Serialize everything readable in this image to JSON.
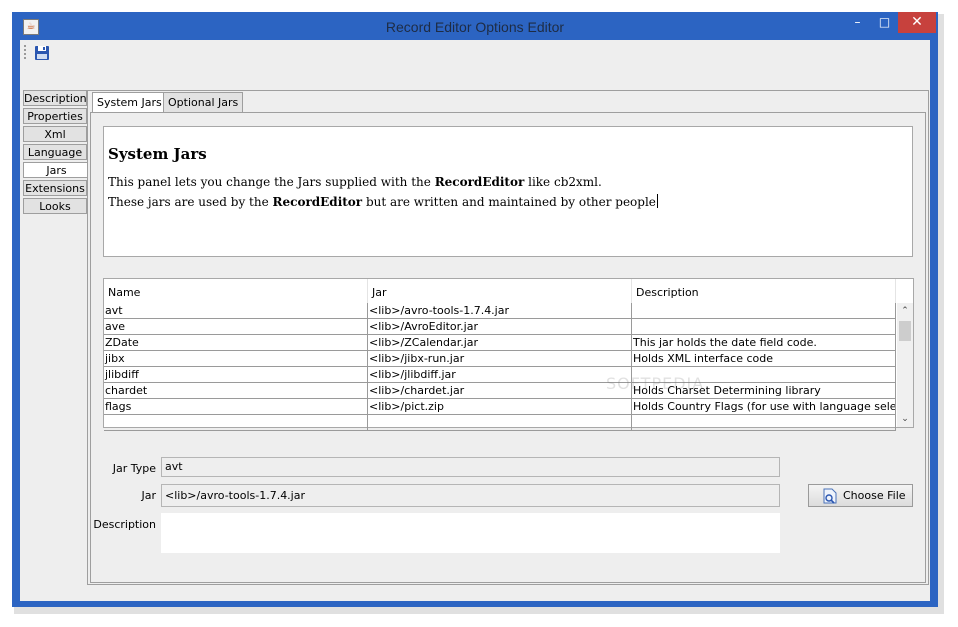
{
  "window": {
    "title": "Record Editor Options Editor",
    "app_icon": "java-icon",
    "controls": {
      "minimize": "–",
      "maximize": "□",
      "close": "✕"
    }
  },
  "toolbar": {
    "save_icon": "save-icon"
  },
  "side_tabs": [
    {
      "label": "Description",
      "active": false
    },
    {
      "label": "Properties",
      "active": false
    },
    {
      "label": "Xml",
      "active": false
    },
    {
      "label": "Language",
      "active": false
    },
    {
      "label": "Jars",
      "active": true
    },
    {
      "label": "Extensions",
      "active": false
    },
    {
      "label": "Looks",
      "active": false
    }
  ],
  "top_tabs": [
    {
      "label": "System Jars",
      "active": true
    },
    {
      "label": "Optional Jars",
      "active": false
    }
  ],
  "info": {
    "title": "System Jars",
    "line1_pre": "This panel lets you change the Jars supplied with the ",
    "line1_bold": "RecordEditor",
    "line1_post": " like cb2xml.",
    "line2_pre": "These jars are used by the ",
    "line2_bold": "RecordEditor",
    "line2_post": " but are written and maintained by other people"
  },
  "table": {
    "columns": [
      "Name",
      "Jar",
      "Description"
    ],
    "rows": [
      [
        "avt",
        "<lib>/avro-tools-1.7.4.jar",
        ""
      ],
      [
        "ave",
        "<lib>/AvroEditor.jar",
        ""
      ],
      [
        "ZDate",
        "<lib>/ZCalendar.jar",
        "This jar holds the date field code."
      ],
      [
        "jibx",
        "<lib>/jibx-run.jar",
        "Holds XML interface code"
      ],
      [
        "jlibdiff",
        "<lib>/jlibdiff.jar",
        ""
      ],
      [
        "chardet",
        "<lib>/chardet.jar",
        "Holds Charset Determining library"
      ],
      [
        "flags",
        "<lib>/pict.zip",
        "Holds Country Flags (for use with language selection)"
      ],
      [
        "",
        "",
        ""
      ]
    ]
  },
  "form": {
    "jar_type_label": "Jar Type",
    "jar_type_value": "avt",
    "jar_label": "Jar",
    "jar_value": "<lib>/avro-tools-1.7.4.jar",
    "description_label": "Description",
    "description_value": "",
    "choose_file_label": "Choose File"
  },
  "watermark": "SOFTPEDIA"
}
